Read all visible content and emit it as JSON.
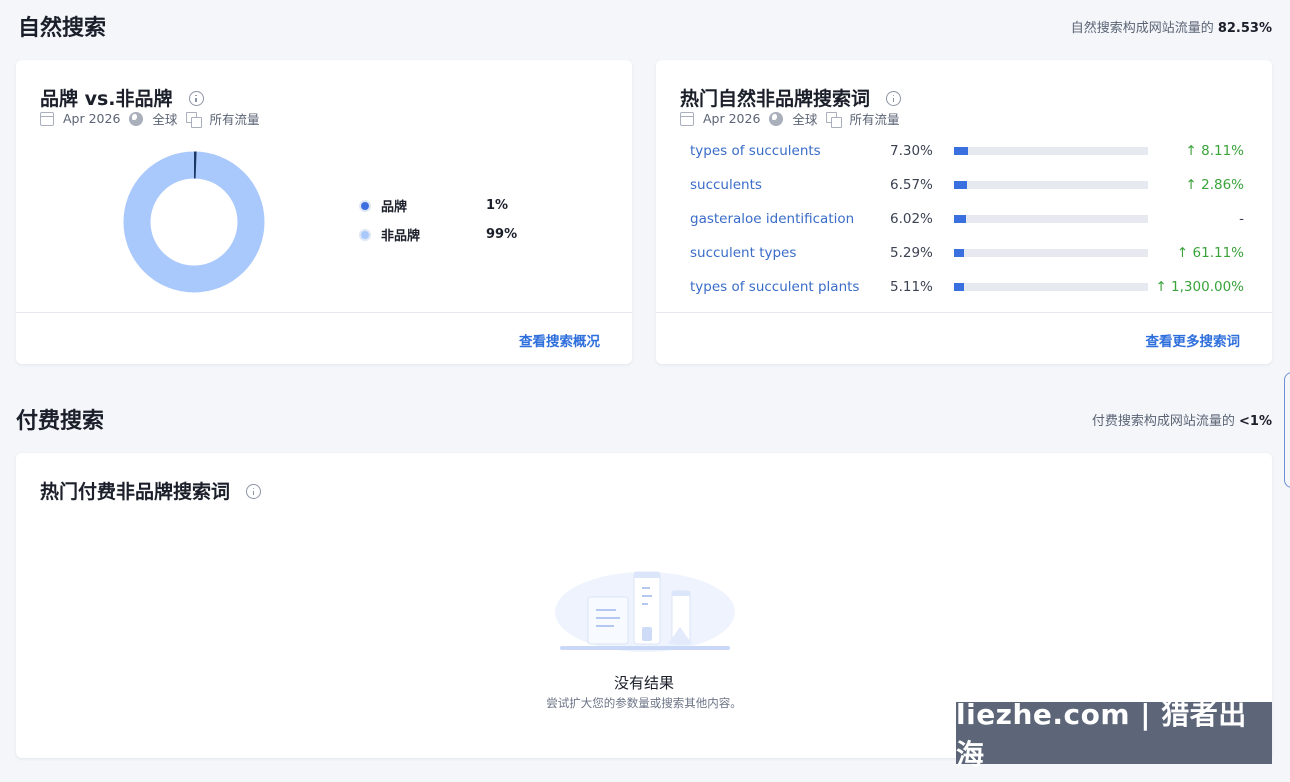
{
  "organic": {
    "title": "自然搜索",
    "share_prefix": "自然搜索构成网站流量的",
    "share_value": "82.53%"
  },
  "brand_card": {
    "title": "品牌 vs.非品牌",
    "meta": {
      "date": "Apr 2026",
      "region": "全球",
      "traffic": "所有流量"
    },
    "legend": [
      {
        "label": "品牌",
        "value": "1%",
        "color": "#3d6ee0"
      },
      {
        "label": "非品牌",
        "value": "99%",
        "color": "#a9c8fb"
      }
    ],
    "donut": {
      "brand_pct": 1,
      "nonbrand_pct": 99,
      "brand_color": "#1b3866",
      "nonbrand_color": "#a9c8fb"
    },
    "link": "查看搜索概况"
  },
  "keywords_card": {
    "title": "热门自然非品牌搜索词",
    "meta": {
      "date": "Apr 2026",
      "region": "全球",
      "traffic": "所有流量"
    },
    "rows": [
      {
        "keyword": "types of succulents",
        "share": "7.30%",
        "share_value": 7.3,
        "change": "8.11%",
        "direction": "up"
      },
      {
        "keyword": "succulents",
        "share": "6.57%",
        "share_value": 6.57,
        "change": "2.86%",
        "direction": "up"
      },
      {
        "keyword": "gasteraloe identification",
        "share": "6.02%",
        "share_value": 6.02,
        "change": "-",
        "direction": "none"
      },
      {
        "keyword": "succulent types",
        "share": "5.29%",
        "share_value": 5.29,
        "change": "61.11%",
        "direction": "up"
      },
      {
        "keyword": "types of succulent plants",
        "share": "5.11%",
        "share_value": 5.11,
        "change": "1,300.00%",
        "direction": "up"
      }
    ],
    "link": "查看更多搜索词"
  },
  "paid": {
    "title": "付费搜索",
    "share_prefix": "付费搜索构成网站流量的",
    "share_value": "<1%"
  },
  "paid_card": {
    "title": "热门付费非品牌搜索词",
    "empty_title": "没有结果",
    "empty_subtitle": "尝试扩大您的参数量或搜索其他内容。"
  },
  "watermark": "liezhe.com | 猎者出海"
}
